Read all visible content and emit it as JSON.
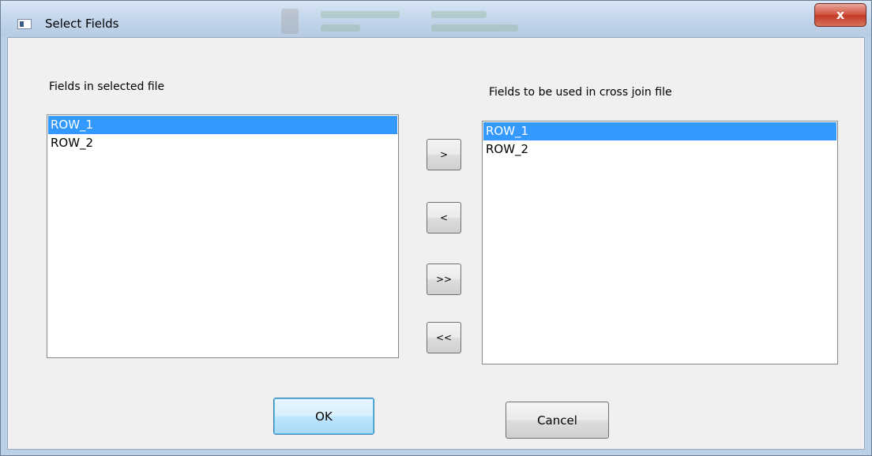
{
  "window": {
    "title": "Select Fields",
    "close_glyph": "x",
    "icon": "app-window-icon"
  },
  "left_panel": {
    "label": "Fields in selected file",
    "items": [
      {
        "label": "ROW_1",
        "selected": true
      },
      {
        "label": "ROW_2",
        "selected": false
      }
    ]
  },
  "right_panel": {
    "label": "Fields to be used in cross join file",
    "items": [
      {
        "label": "ROW_1",
        "selected": true
      },
      {
        "label": "ROW_2",
        "selected": false
      }
    ]
  },
  "transfer_buttons": {
    "add": ">",
    "remove": "<",
    "add_all": ">>",
    "remove_all": "<<"
  },
  "footer": {
    "ok_label": "OK",
    "cancel_label": "Cancel"
  },
  "colors": {
    "selection": "#3399ff",
    "close_button": "#c23a26",
    "titlebar": "#c3d6eb"
  }
}
